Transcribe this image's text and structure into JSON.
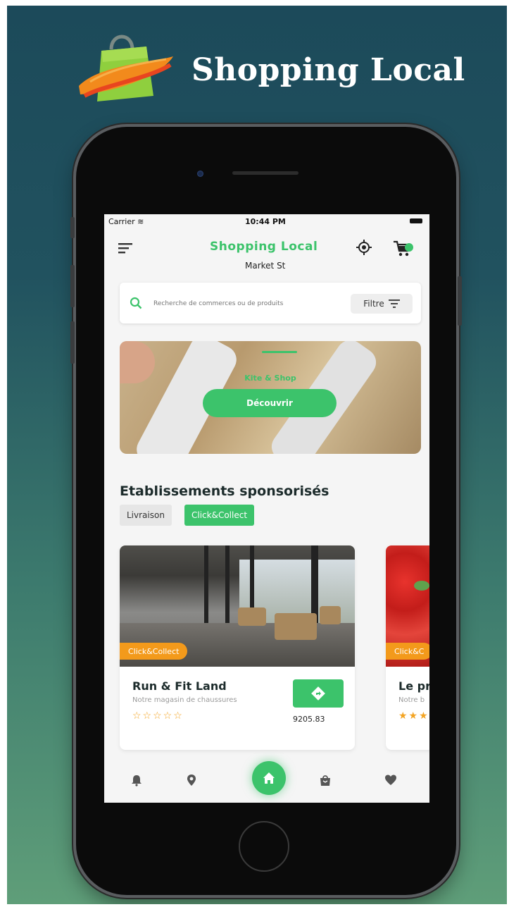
{
  "brand": {
    "title": "Shopping Local"
  },
  "status_bar": {
    "carrier": "Carrier",
    "time": "10:44 PM"
  },
  "header": {
    "title": "Shopping Local",
    "location": "Market St"
  },
  "search": {
    "placeholder": "Recherche de commerces ou de produits",
    "filter_label": "Filtre"
  },
  "banner": {
    "kicker": "Kite & Shop",
    "cta_label": "Découvrir"
  },
  "section": {
    "title": "Etablissements sponsorisés",
    "chips": [
      {
        "label": "Livraison",
        "active": false
      },
      {
        "label": "Click&Collect",
        "active": true
      }
    ]
  },
  "cards": [
    {
      "badge": "Click&Collect",
      "name": "Run & Fit Land",
      "description": "Notre magasin de chaussures",
      "rating": 0,
      "stars": "☆☆☆☆☆",
      "distance": "9205.83"
    },
    {
      "badge": "Click&C",
      "name": "Le pri",
      "description": "Notre b",
      "stars": "★★★"
    }
  ],
  "icons": {
    "menu": "menu-icon",
    "target": "crosshair-icon",
    "cart": "cart-icon",
    "search": "search-icon",
    "filter": "filter-icon",
    "directions": "directions-icon",
    "nav": [
      "bell-icon",
      "map-pin-icon",
      "home-icon",
      "bag-icon",
      "heart-icon"
    ]
  },
  "colors": {
    "accent": "#3cc36b",
    "badge": "#f39a1b",
    "star": "#f3a423",
    "cart_badge": "#3cc36b"
  }
}
